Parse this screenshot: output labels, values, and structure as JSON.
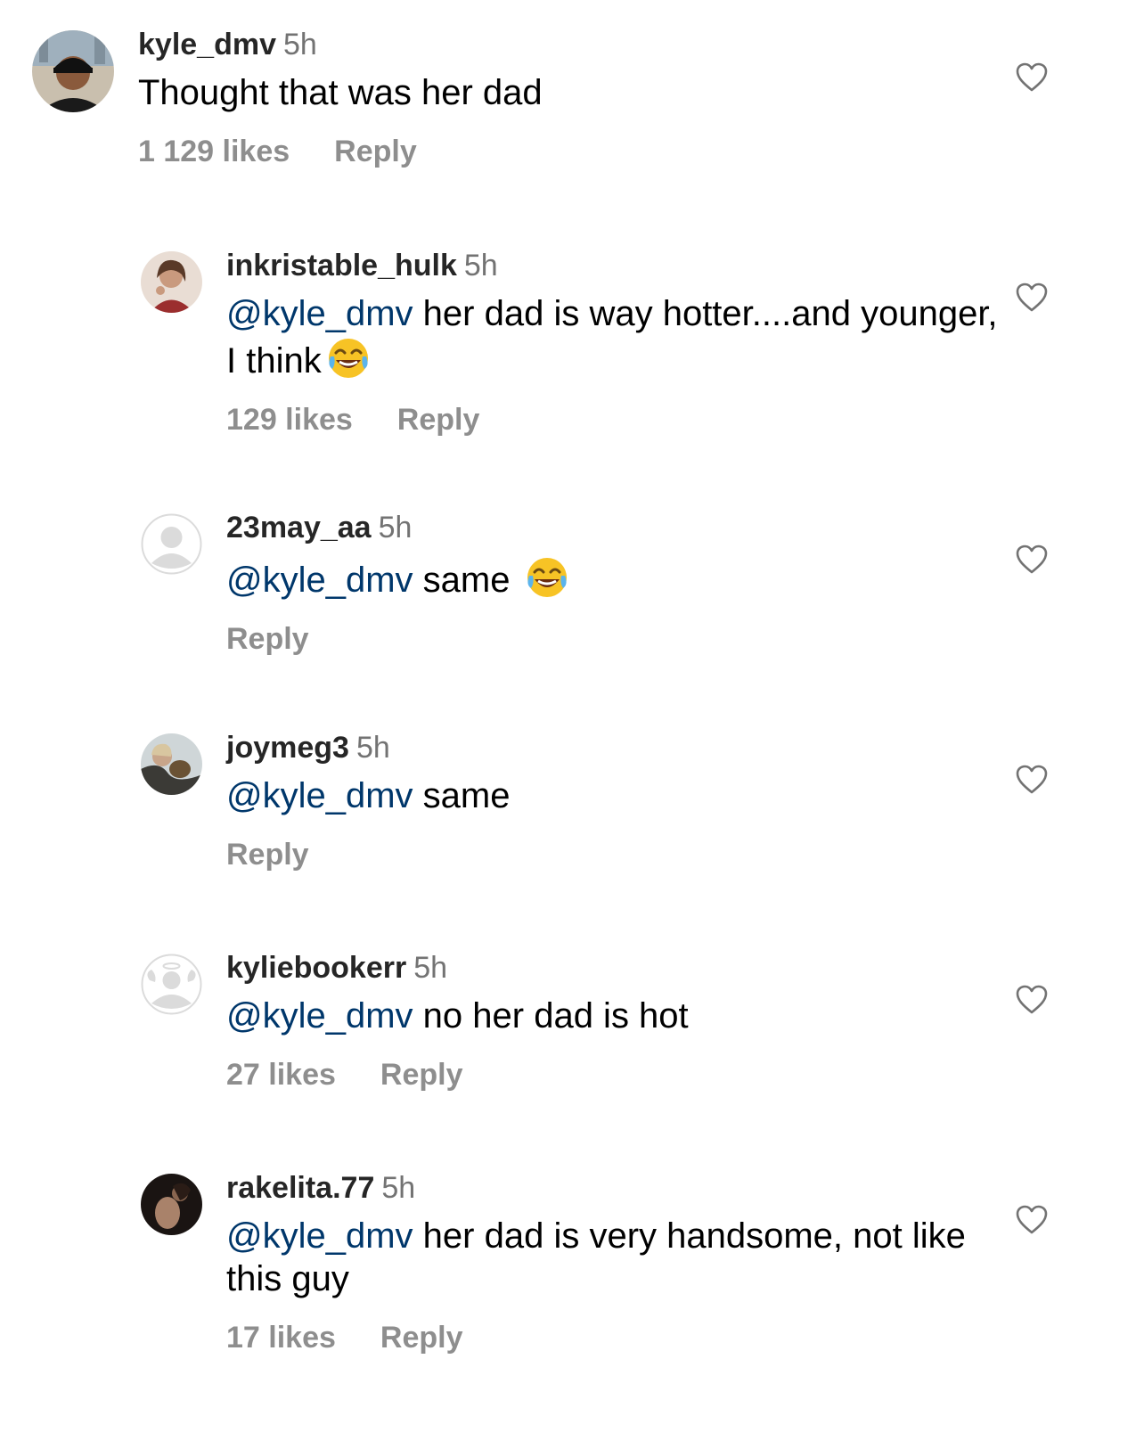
{
  "comments": [
    {
      "username": "kyle_dmv",
      "time": "5h",
      "mention": "",
      "text": "Thought that was her dad",
      "likes": "1 129 likes",
      "reply_label": "Reply"
    },
    {
      "username": "inkristable_hulk",
      "time": "5h",
      "mention": "@kyle_dmv",
      "text": " her dad is way hotter....and younger, I think",
      "emoji": "tears-of-joy-emoji",
      "likes": "129 likes",
      "reply_label": "Reply"
    },
    {
      "username": "23may_aa",
      "time": "5h",
      "mention": "@kyle_dmv",
      "text": " same ",
      "emoji": "tears-of-joy-emoji",
      "likes": "",
      "reply_label": "Reply"
    },
    {
      "username": "joymeg3",
      "time": "5h",
      "mention": "@kyle_dmv",
      "text": " same",
      "likes": "",
      "reply_label": "Reply"
    },
    {
      "username": "kyliebookerr",
      "time": "5h",
      "mention": "@kyle_dmv",
      "text": " no her dad is hot",
      "likes": "27 likes",
      "reply_label": "Reply"
    },
    {
      "username": "rakelita.77",
      "time": "5h",
      "mention": "@kyle_dmv",
      "text": " her dad is very handsome, not like this guy",
      "likes": "17 likes",
      "reply_label": "Reply"
    }
  ],
  "icons": {
    "like": "heart-outline-icon",
    "default_avatar": "default-avatar-icon"
  },
  "colors": {
    "mention": "#00376b",
    "meta": "#8e8e8e",
    "time": "#737373"
  }
}
